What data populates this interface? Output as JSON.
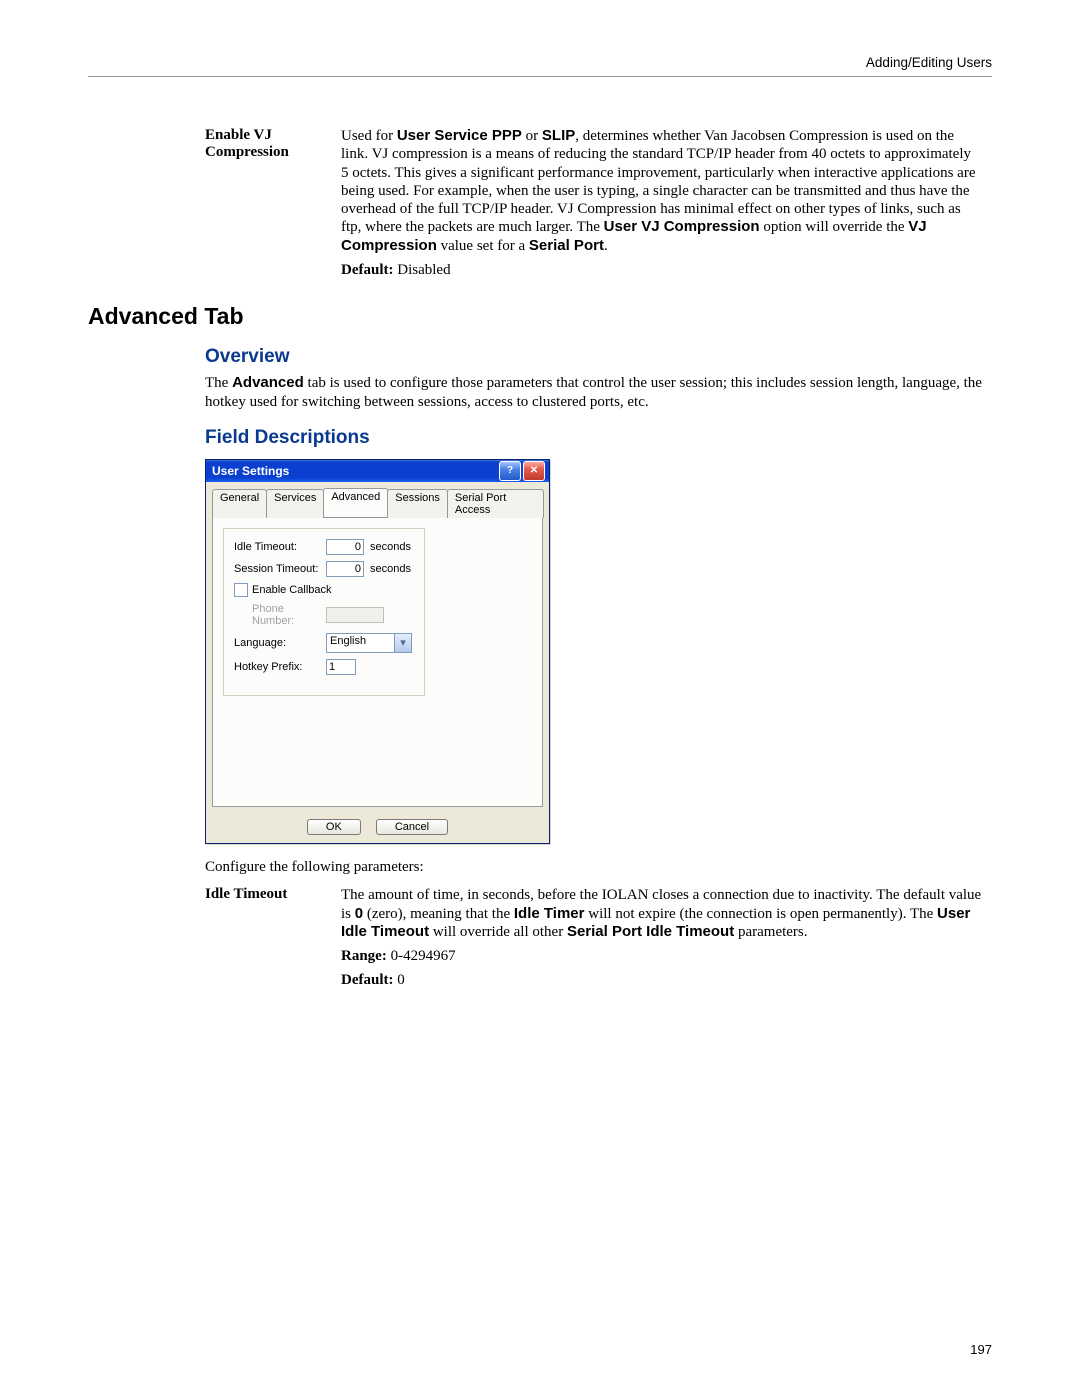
{
  "header": {
    "section": "Adding/Editing Users"
  },
  "vj": {
    "term": "Enable VJ Compression",
    "body_a": "Used for ",
    "body_b": "User Service PPP",
    "body_c": " or ",
    "body_d": "SLIP",
    "body_e": ", determines whether Van Jacobsen Compression is used on the link. VJ compression is a means of reducing the standard TCP/IP header from 40 octets to approximately 5 octets. This gives a significant performance improvement, particularly when interactive applications are being used. For example, when the user is typing, a single character can be transmitted and thus have the overhead of the full TCP/IP header. VJ Compression has minimal effect on other types of links, such as ftp, where the packets are much larger. The ",
    "body_f": "User VJ Compression",
    "body_g": " option will override the ",
    "body_h": "VJ Compression",
    "body_i": " value set for a ",
    "body_j": "Serial Port",
    "body_k": ".",
    "default_label": "Default:",
    "default_value": " Disabled"
  },
  "h2": "Advanced Tab",
  "overview": {
    "heading": "Overview",
    "p_a": "The ",
    "p_b": "Advanced",
    "p_c": " tab is used to configure those parameters that control the user session; this includes session length, language, the hotkey used for switching between sessions, access to clustered ports, etc."
  },
  "field_desc": {
    "heading": "Field Descriptions"
  },
  "dialog": {
    "title": "User Settings",
    "tabs": [
      "General",
      "Services",
      "Advanced",
      "Sessions",
      "Serial Port Access"
    ],
    "active_tab": 2,
    "idle_label": "Idle Timeout:",
    "idle_value": "0",
    "idle_unit": "seconds",
    "session_label": "Session Timeout:",
    "session_value": "0",
    "session_unit": "seconds",
    "callback_label": "Enable Callback",
    "phone_label": "Phone Number:",
    "language_label": "Language:",
    "language_value": "English",
    "hotkey_label": "Hotkey Prefix:",
    "hotkey_value": "1",
    "ok": "OK",
    "cancel": "Cancel"
  },
  "configure_intro": "Configure the following parameters:",
  "idle": {
    "term": "Idle Timeout",
    "b_a": "The amount of time, in seconds, before the IOLAN closes a connection due to inactivity. The default value is ",
    "b_b": "0",
    "b_c": " (zero), meaning that the ",
    "b_d": "Idle Timer",
    "b_e": " will not expire (the connection is open permanently). The ",
    "b_f": "User Idle Timeout",
    "b_g": " will override all other ",
    "b_h": "Serial Port Idle Timeout",
    "b_i": " parameters.",
    "range_label": "Range:",
    "range_value": " 0-4294967",
    "default_label": "Default:",
    "default_value": " 0"
  },
  "page_number": "197"
}
